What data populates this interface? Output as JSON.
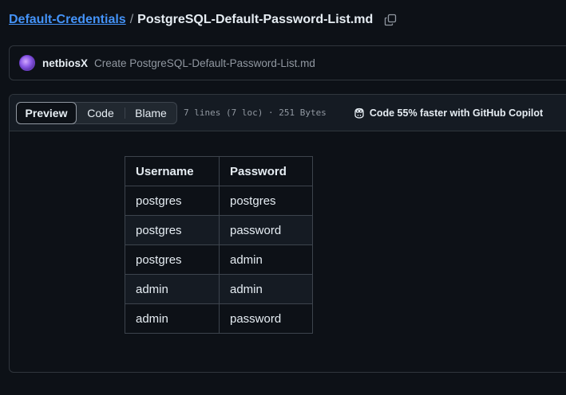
{
  "breadcrumb": {
    "repo": "Default-Credentials",
    "separator": "/",
    "file": "PostgreSQL-Default-Password-List.md"
  },
  "commit": {
    "author": "netbiosX",
    "message": "Create PostgreSQL-Default-Password-List.md"
  },
  "file_header": {
    "tabs": [
      "Preview",
      "Code",
      "Blame"
    ],
    "active_tab": "Preview",
    "meta": "7 lines (7 loc) · 251 Bytes",
    "copilot": "Code 55% faster with GitHub Copilot"
  },
  "table": {
    "headers": [
      "Username",
      "Password"
    ],
    "rows": [
      [
        "postgres",
        "postgres"
      ],
      [
        "postgres",
        "password"
      ],
      [
        "postgres",
        "admin"
      ],
      [
        "admin",
        "admin"
      ],
      [
        "admin",
        "password"
      ]
    ]
  },
  "colors": {
    "background": "#0d1117",
    "link": "#4493f8",
    "border": "#30363d",
    "muted": "#9198a1"
  }
}
